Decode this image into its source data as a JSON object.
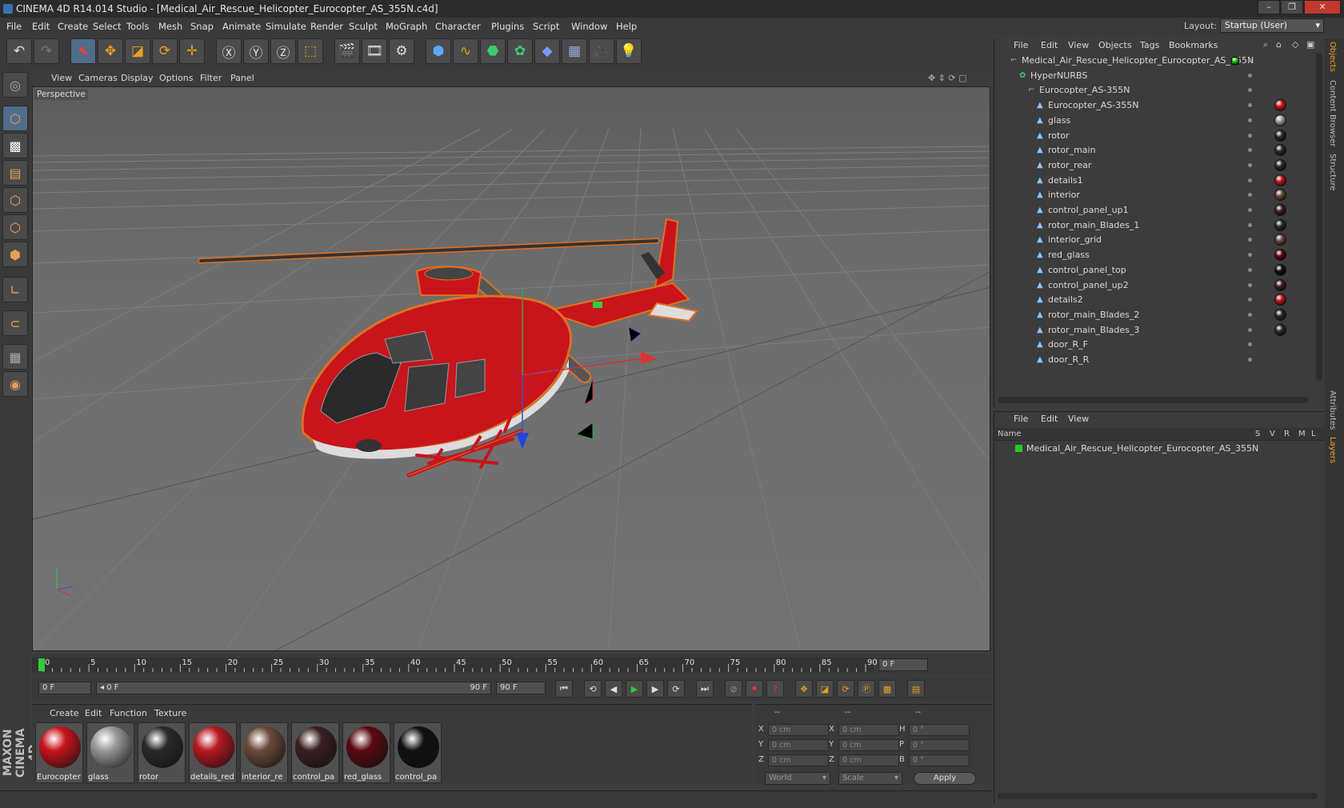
{
  "window": {
    "title": "CINEMA 4D R14.014 Studio - [Medical_Air_Rescue_Helicopter_Eurocopter_AS_355N.c4d]"
  },
  "menubar": [
    "File",
    "Edit",
    "Create",
    "Select",
    "Tools",
    "Mesh",
    "Snap",
    "Animate",
    "Simulate",
    "Render",
    "Sculpt",
    "MoGraph",
    "Character",
    "Plugins",
    "Script",
    "Window",
    "Help"
  ],
  "layout": {
    "label": "Layout:",
    "value": "Startup (User)"
  },
  "viewport": {
    "menu": [
      "View",
      "Cameras",
      "Display",
      "Options",
      "Filter",
      "Panel"
    ],
    "label": "Perspective"
  },
  "timeline": {
    "ticks": [
      "0",
      "5",
      "10",
      "15",
      "20",
      "25",
      "30",
      "35",
      "40",
      "45",
      "50",
      "55",
      "60",
      "65",
      "70",
      "75",
      "80",
      "85",
      "90"
    ],
    "current_frame": "0 F"
  },
  "transport": {
    "start": "0 F",
    "range_start": "0 F",
    "range_end": "90 F",
    "end": "90 F"
  },
  "materials": {
    "menu": [
      "Create",
      "Edit",
      "Function",
      "Texture"
    ],
    "items": [
      {
        "name": "Eurocopter",
        "color": "#c8141b"
      },
      {
        "name": "glass",
        "color": "#9a9a9a"
      },
      {
        "name": "rotor",
        "color": "#2a2a2a"
      },
      {
        "name": "details_red",
        "color": "#b81820"
      },
      {
        "name": "interior_re",
        "color": "#6a4a3a"
      },
      {
        "name": "control_pa",
        "color": "#3a2020"
      },
      {
        "name": "red_glass",
        "color": "#5a0a10"
      },
      {
        "name": "control_pa",
        "color": "#101010"
      }
    ]
  },
  "coords": {
    "headers": [
      "--",
      "--",
      "--"
    ],
    "rows": [
      {
        "a": "X",
        "av": "0 cm",
        "b": "X",
        "bv": "0 cm",
        "c": "H",
        "cv": "0 °"
      },
      {
        "a": "Y",
        "av": "0 cm",
        "b": "Y",
        "bv": "0 cm",
        "c": "P",
        "cv": "0 °"
      },
      {
        "a": "Z",
        "av": "0 cm",
        "b": "Z",
        "bv": "0 cm",
        "c": "B",
        "cv": "0 °"
      }
    ],
    "world": "World",
    "scale": "Scale",
    "apply": "Apply"
  },
  "objects": {
    "menu": [
      "File",
      "Edit",
      "View",
      "Objects",
      "Tags",
      "Bookmarks"
    ],
    "rows": [
      {
        "name": "Medical_Air_Rescue_Helicopter_Eurocopter_AS_355N",
        "indent": 0,
        "tag": "#22cc22"
      },
      {
        "name": "HyperNURBS",
        "indent": 1,
        "tag": ""
      },
      {
        "name": "Eurocopter_AS-355N",
        "indent": 2,
        "tag": ""
      },
      {
        "name": "Eurocopter_AS-355N",
        "indent": 3,
        "tag": "#c8141b"
      },
      {
        "name": "glass",
        "indent": 3,
        "tag": "#9a9a9a"
      },
      {
        "name": "rotor",
        "indent": 3,
        "tag": "#2a2a2a"
      },
      {
        "name": "rotor_main",
        "indent": 3,
        "tag": "#2a2a2a"
      },
      {
        "name": "rotor_rear",
        "indent": 3,
        "tag": "#2a2a2a"
      },
      {
        "name": "details1",
        "indent": 3,
        "tag": "#b81820"
      },
      {
        "name": "interior",
        "indent": 3,
        "tag": "#6a4a3a"
      },
      {
        "name": "control_panel_up1",
        "indent": 3,
        "tag": "#3a2020"
      },
      {
        "name": "rotor_main_Blades_1",
        "indent": 3,
        "tag": "#2a2a2a"
      },
      {
        "name": "interior_grid",
        "indent": 3,
        "tag": "#6a4a3a"
      },
      {
        "name": "red_glass",
        "indent": 3,
        "tag": "#5a0a10"
      },
      {
        "name": "control_panel_top",
        "indent": 3,
        "tag": "#101010"
      },
      {
        "name": "control_panel_up2",
        "indent": 3,
        "tag": "#3a2020"
      },
      {
        "name": "details2",
        "indent": 3,
        "tag": "#b81820"
      },
      {
        "name": "rotor_main_Blades_2",
        "indent": 3,
        "tag": "#2a2a2a"
      },
      {
        "name": "rotor_main_Blades_3",
        "indent": 3,
        "tag": "#2a2a2a"
      },
      {
        "name": "door_R_F",
        "indent": 3,
        "tag": ""
      },
      {
        "name": "door_R_R",
        "indent": 3,
        "tag": ""
      }
    ]
  },
  "layers": {
    "menu": [
      "File",
      "Edit",
      "View"
    ],
    "columns": [
      "Name",
      "S",
      "V",
      "R",
      "M",
      "L"
    ],
    "rows": [
      {
        "name": "Medical_Air_Rescue_Helicopter_Eurocopter_AS_355N"
      }
    ]
  },
  "sidetabs": [
    "Objects",
    "Content Browser",
    "Structure",
    "Attributes",
    "Layers"
  ],
  "brand": "MAXON CINEMA 4D"
}
